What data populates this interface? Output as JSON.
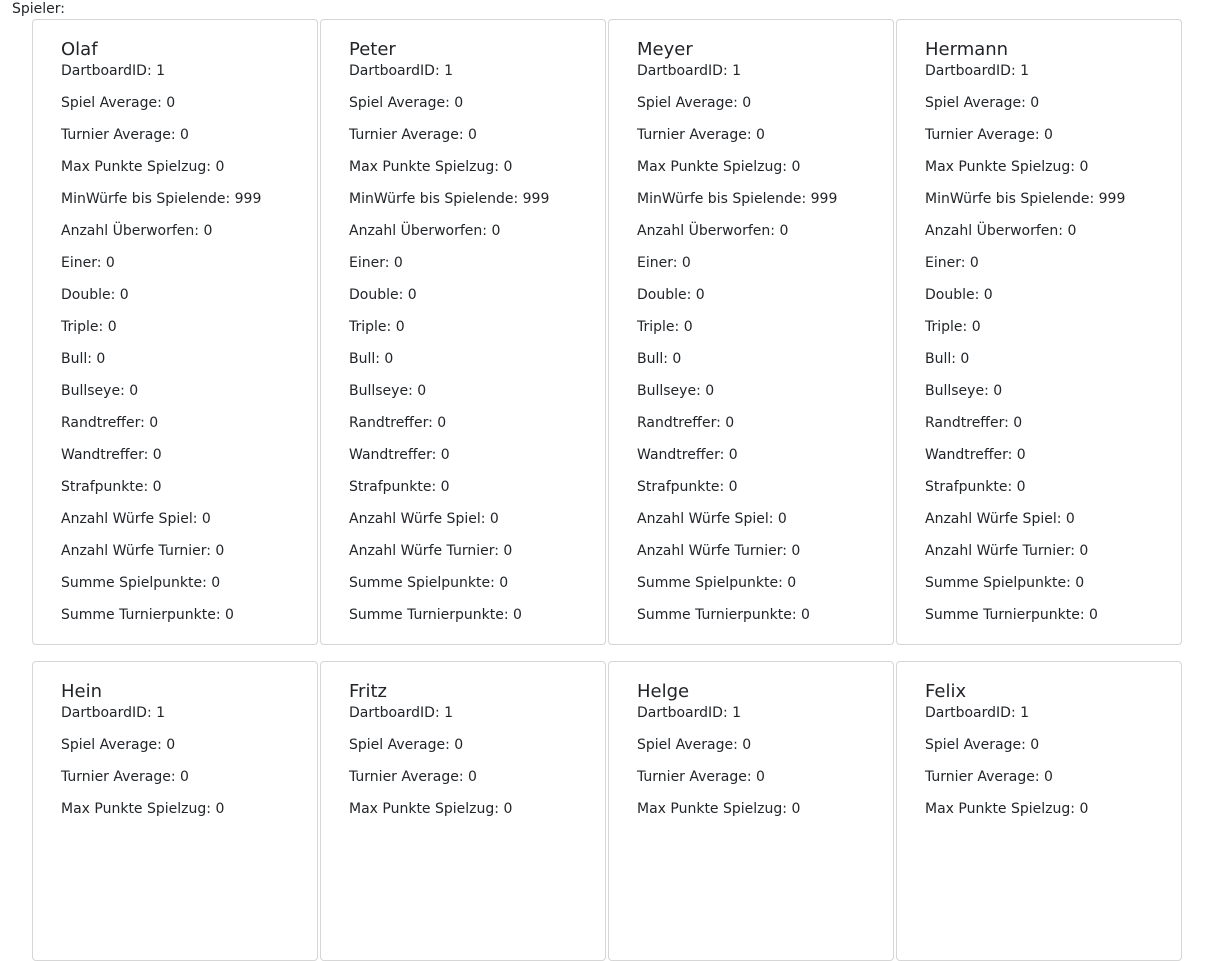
{
  "section_label": "Spieler:",
  "players": [
    {
      "name": "Olaf",
      "stats": [
        "DartboardID: 1",
        "Spiel Average: 0",
        "Turnier Average: 0",
        "Max Punkte Spielzug: 0",
        "MinWürfe bis Spielende: 999",
        "Anzahl Überworfen: 0",
        "Einer: 0",
        "Double: 0",
        "Triple: 0",
        "Bull: 0",
        "Bullseye: 0",
        "Randtreffer: 0",
        "Wandtreffer: 0",
        "Strafpunkte: 0",
        "Anzahl Würfe Spiel: 0",
        "Anzahl Würfe Turnier: 0",
        "Summe Spielpunkte: 0",
        "Summe Turnierpunkte: 0"
      ]
    },
    {
      "name": "Peter",
      "stats": [
        "DartboardID: 1",
        "Spiel Average: 0",
        "Turnier Average: 0",
        "Max Punkte Spielzug: 0",
        "MinWürfe bis Spielende: 999",
        "Anzahl Überworfen: 0",
        "Einer: 0",
        "Double: 0",
        "Triple: 0",
        "Bull: 0",
        "Bullseye: 0",
        "Randtreffer: 0",
        "Wandtreffer: 0",
        "Strafpunkte: 0",
        "Anzahl Würfe Spiel: 0",
        "Anzahl Würfe Turnier: 0",
        "Summe Spielpunkte: 0",
        "Summe Turnierpunkte: 0"
      ]
    },
    {
      "name": "Meyer",
      "stats": [
        "DartboardID: 1",
        "Spiel Average: 0",
        "Turnier Average: 0",
        "Max Punkte Spielzug: 0",
        "MinWürfe bis Spielende: 999",
        "Anzahl Überworfen: 0",
        "Einer: 0",
        "Double: 0",
        "Triple: 0",
        "Bull: 0",
        "Bullseye: 0",
        "Randtreffer: 0",
        "Wandtreffer: 0",
        "Strafpunkte: 0",
        "Anzahl Würfe Spiel: 0",
        "Anzahl Würfe Turnier: 0",
        "Summe Spielpunkte: 0",
        "Summe Turnierpunkte: 0"
      ]
    },
    {
      "name": "Hermann",
      "stats": [
        "DartboardID: 1",
        "Spiel Average: 0",
        "Turnier Average: 0",
        "Max Punkte Spielzug: 0",
        "MinWürfe bis Spielende: 999",
        "Anzahl Überworfen: 0",
        "Einer: 0",
        "Double: 0",
        "Triple: 0",
        "Bull: 0",
        "Bullseye: 0",
        "Randtreffer: 0",
        "Wandtreffer: 0",
        "Strafpunkte: 0",
        "Anzahl Würfe Spiel: 0",
        "Anzahl Würfe Turnier: 0",
        "Summe Spielpunkte: 0",
        "Summe Turnierpunkte: 0"
      ]
    },
    {
      "name": "Hein",
      "stats": [
        "DartboardID: 1",
        "Spiel Average: 0",
        "Turnier Average: 0",
        "Max Punkte Spielzug: 0"
      ]
    },
    {
      "name": "Fritz",
      "stats": [
        "DartboardID: 1",
        "Spiel Average: 0",
        "Turnier Average: 0",
        "Max Punkte Spielzug: 0"
      ]
    },
    {
      "name": "Helge",
      "stats": [
        "DartboardID: 1",
        "Spiel Average: 0",
        "Turnier Average: 0",
        "Max Punkte Spielzug: 0"
      ]
    },
    {
      "name": "Felix",
      "stats": [
        "DartboardID: 1",
        "Spiel Average: 0",
        "Turnier Average: 0",
        "Max Punkte Spielzug: 0"
      ]
    }
  ]
}
